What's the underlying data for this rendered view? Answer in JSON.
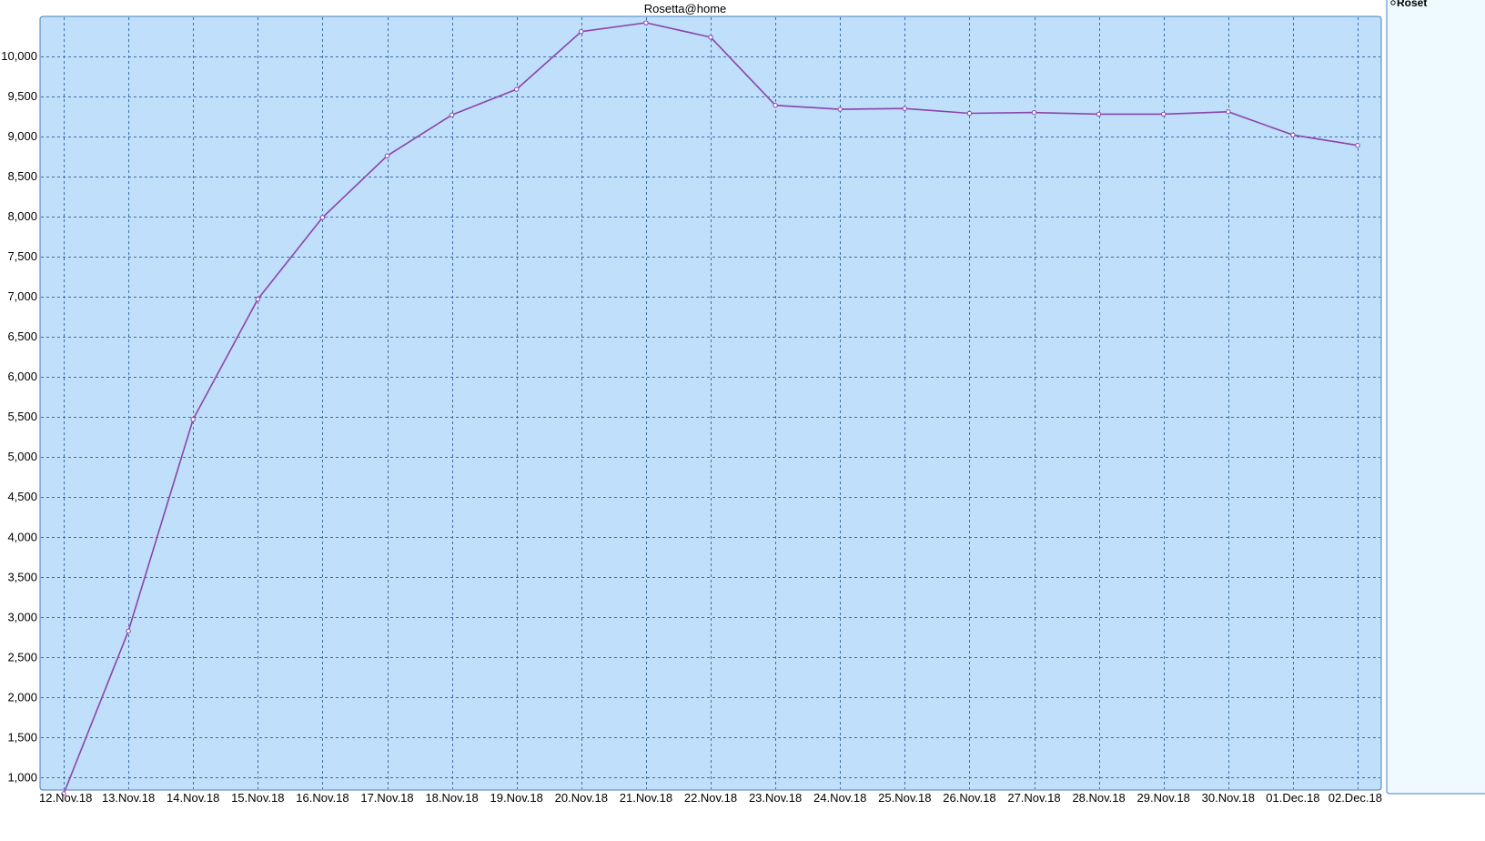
{
  "chart_data": {
    "type": "line",
    "title": "Rosetta@home",
    "xlabel": "",
    "ylabel": "",
    "categories": [
      "12.Nov.18",
      "13.Nov.18",
      "14.Nov.18",
      "15.Nov.18",
      "16.Nov.18",
      "17.Nov.18",
      "18.Nov.18",
      "19.Nov.18",
      "20.Nov.18",
      "21.Nov.18",
      "22.Nov.18",
      "23.Nov.18",
      "24.Nov.18",
      "25.Nov.18",
      "26.Nov.18",
      "27.Nov.18",
      "28.Nov.18",
      "29.Nov.18",
      "30.Nov.18",
      "01.Dec.18",
      "02.Dec.18"
    ],
    "series": [
      {
        "name": "Roset",
        "color": "#8b44ac",
        "values": [
          800,
          2830,
          5470,
          6970,
          7990,
          8760,
          9270,
          9590,
          10310,
          10420,
          10240,
          9390,
          9340,
          9350,
          9290,
          9300,
          9280,
          9280,
          9310,
          9020,
          8890
        ]
      }
    ],
    "y_ticks": [
      1000,
      1500,
      2000,
      2500,
      3000,
      3500,
      4000,
      4500,
      5000,
      5500,
      6000,
      6500,
      7000,
      7500,
      8000,
      8500,
      9000,
      9500,
      10000
    ],
    "y_tick_labels": [
      "1,000",
      "1,500",
      "2,000",
      "2,500",
      "3,000",
      "3,500",
      "4,000",
      "4,500",
      "5,000",
      "5,500",
      "6,000",
      "6,500",
      "7,000",
      "7,500",
      "8,000",
      "8,500",
      "9,000",
      "9,500",
      "10,000"
    ],
    "ylim": [
      800,
      10500
    ],
    "grid": true,
    "legend_position": "right",
    "colors": {
      "plot_background": "#bfdffb",
      "plot_border": "#4a7fc0",
      "grid": "#3d6fa6",
      "line": "#8b44ac",
      "marker_fill": "#ffffff",
      "legend_background": "#eefaff",
      "legend_border": "#4a7fc0"
    }
  }
}
